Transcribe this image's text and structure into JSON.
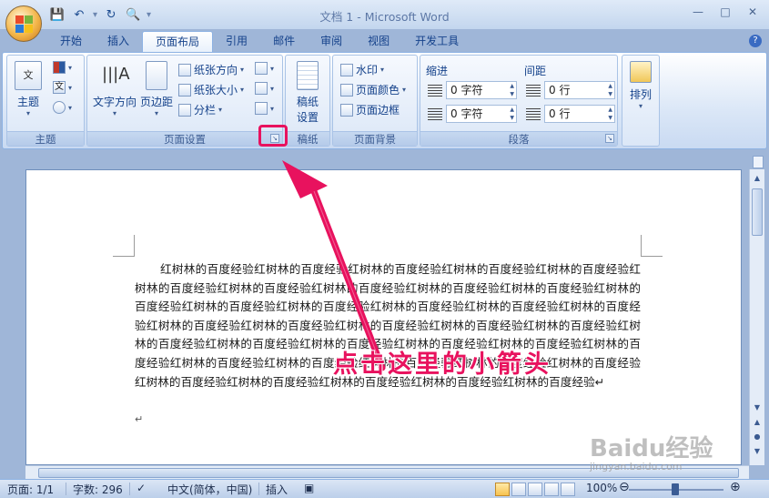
{
  "window": {
    "title": "文档 1 - Microsoft Word"
  },
  "qat": {
    "items": [
      "save-icon",
      "undo-icon",
      "redo-icon",
      "print-preview-icon"
    ]
  },
  "tabs": [
    "开始",
    "插入",
    "页面布局",
    "引用",
    "邮件",
    "审阅",
    "视图",
    "开发工具"
  ],
  "active_tab": "页面布局",
  "ribbon": {
    "theme_group": {
      "label": "主题",
      "theme_button": "主题"
    },
    "page_setup": {
      "label": "页面设置",
      "text_direction": "文字方向",
      "margins": "页边距",
      "orientation": "纸张方向",
      "size": "纸张大小",
      "columns": "分栏"
    },
    "manuscript": {
      "label": "稿纸",
      "button": "稿纸\n设置",
      "line1": "稿纸",
      "line2": "设置"
    },
    "page_background": {
      "label": "页面背景",
      "watermark": "水印",
      "page_color": "页面颜色",
      "page_borders": "页面边框"
    },
    "paragraph": {
      "label": "段落",
      "indent_title": "缩进",
      "spacing_title": "间距",
      "indent_left": "0 字符",
      "indent_right": "0 字符",
      "spacing_before": "0 行",
      "spacing_after": "0 行"
    },
    "arrange": {
      "label": "排列"
    }
  },
  "document": {
    "text": "红树林的百度经验红树林的百度经验红树林的百度经验红树林的百度经验红树林的百度经验红树林的百度经验红树林的百度经验红树林的百度经验红树林的百度经验红树林的百度经验红树林的百度经验红树林的百度经验红树林的百度经验红树林的百度经验红树林的百度经验红树林的百度经验红树林的百度经验红树林的百度经验红树林的百度经验红树林的百度经验红树林的百度经验红树林的百度经验红树林的百度经验红树林的百度经验红树林的百度经验红树林的百度经验红树林的百度经验红树林的百度经验红树林的百度经验红树林的百度经验红树林的百度经验红树林的百度经验红树林的百度经验红树林的百度经验红树林的百度经验红树林的百度经验红树林的百度经验↵",
    "empty_paragraph": "↵"
  },
  "annotation": {
    "text": "点击这里的小箭头",
    "color": "#e8125e"
  },
  "status": {
    "page": "页面: 1/1",
    "words": "字数: 296",
    "language": "中文(简体，中国)",
    "mode": "插入",
    "zoom": "100%"
  },
  "watermark": {
    "logo": "Baidu经验",
    "url": "jingyan.baidu.com"
  }
}
